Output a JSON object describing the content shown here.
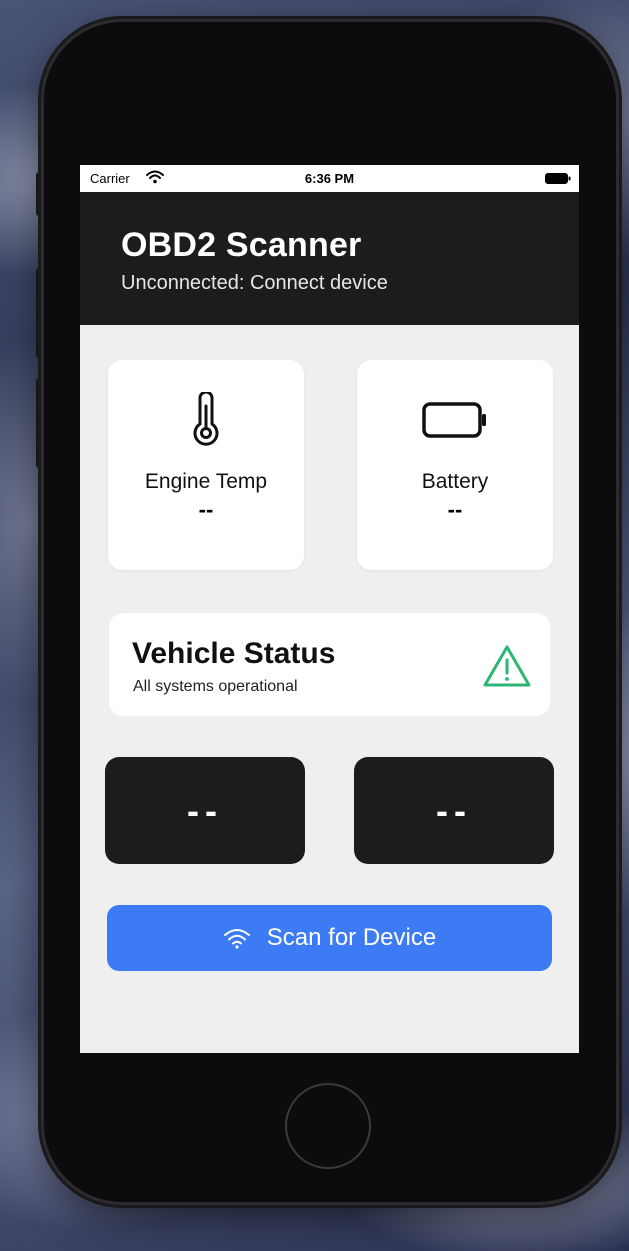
{
  "status_bar": {
    "carrier": "Carrier",
    "time": "6:36 PM",
    "icons": [
      "wifi-icon",
      "battery-full-icon"
    ]
  },
  "header": {
    "title": "OBD2 Scanner",
    "subtitle": "Unconnected: Connect device"
  },
  "cards": {
    "engine_temp": {
      "icon": "thermometer-icon",
      "label": "Engine Temp",
      "value": "--"
    },
    "battery": {
      "icon": "battery-icon",
      "label": "Battery",
      "value": "--"
    }
  },
  "vehicle_status": {
    "title": "Vehicle Status",
    "subtitle": "All systems operational",
    "icon": "warning-triangle-icon",
    "icon_color": "#2bb673"
  },
  "tiles": {
    "left_value": "--",
    "right_value": "--"
  },
  "scan_button": {
    "label": "Scan for Device",
    "icon": "wifi-icon",
    "color": "#3d7bf4"
  },
  "colors": {
    "header_bg": "#1c1c1e",
    "screen_bg": "#efeff0",
    "tile_bg": "#1c1c1e"
  }
}
